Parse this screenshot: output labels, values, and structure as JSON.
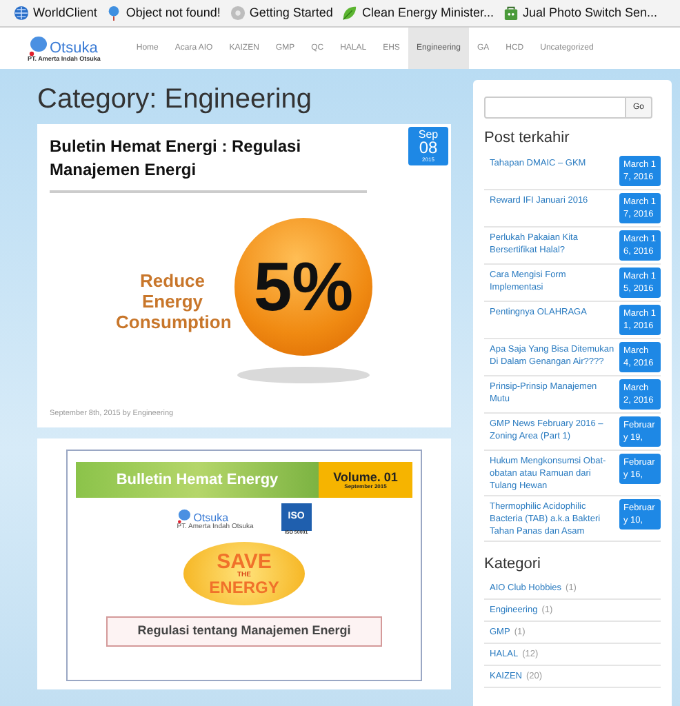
{
  "bookmarks": [
    {
      "label": "WorldClient",
      "kind": "globe"
    },
    {
      "label": "Object not found!",
      "kind": "pin"
    },
    {
      "label": "Getting Started",
      "kind": "disc"
    },
    {
      "label": "Clean Energy Minister...",
      "kind": "leaf"
    },
    {
      "label": "Jual Photo Switch Sen...",
      "kind": "bag"
    }
  ],
  "nav": {
    "logo": {
      "name": "Otsuka",
      "subtitle": "PT. Amerta Indah Otsuka"
    },
    "items": [
      {
        "label": "Home",
        "selected": false
      },
      {
        "label": "Acara AIO",
        "selected": false
      },
      {
        "label": "KAIZEN",
        "selected": false
      },
      {
        "label": "GMP",
        "selected": false
      },
      {
        "label": "QC",
        "selected": false
      },
      {
        "label": "HALAL",
        "selected": false
      },
      {
        "label": "EHS",
        "selected": false
      },
      {
        "label": "Engineering",
        "selected": true
      },
      {
        "label": "GA",
        "selected": false
      },
      {
        "label": "HCD",
        "selected": false
      },
      {
        "label": "Uncategorized",
        "selected": false
      }
    ]
  },
  "page_title": "Category: Engineering",
  "posts": [
    {
      "title": "Buletin Hemat Energi : Regulasi Manajemen Energi",
      "date": {
        "month": "Sep",
        "day": "08",
        "year": "2015"
      },
      "image": {
        "kind": "reduce",
        "caption": "Reduce Energy Consumption",
        "figure": "5%"
      },
      "meta": "September 8th, 2015 by Engineering"
    },
    {
      "image": {
        "kind": "bulletin",
        "banner": "Bulletin Hemat Energy",
        "volume": "Volume. 01",
        "volume_date": "September 2015",
        "logo": "Otsuka",
        "logo_subtitle": "PT. Amerta Indah Otsuka",
        "badge": "ISO",
        "badge_caption": "ISO 50001",
        "slogan_top": "SAVE",
        "slogan_middle": "THE",
        "slogan_bottom": "ENERGY",
        "ribbon": "Regulasi tentang Manajemen Energi"
      }
    }
  ],
  "sidebar": {
    "search": {
      "button": "Go"
    },
    "recent": {
      "heading": "Post terkahir",
      "items": [
        {
          "title": "Tahapan DMAIC – GKM",
          "date": "March 17, 2016"
        },
        {
          "title": "Reward IFI Januari 2016",
          "date": "March 17, 2016"
        },
        {
          "title": "Perlukah Pakaian Kita Bersertifikat Halal?",
          "date": "March 16, 2016"
        },
        {
          "title": "Cara Mengisi Form Implementasi",
          "date": "March 15, 2016"
        },
        {
          "title": "Pentingnya OLAHRAGA",
          "date": "March 11, 2016"
        },
        {
          "title": "Apa Saja Yang Bisa Ditemukan Di Dalam Genangan Air????",
          "date": "March 4, 2016"
        },
        {
          "title": "Prinsip-Prinsip Manajemen Mutu",
          "date": "March 2, 2016"
        },
        {
          "title": "GMP News February 2016 – Zoning Area (Part 1)",
          "date": "February 19,"
        },
        {
          "title": "Hukum Mengkonsumsi Obat-obatan atau Ramuan dari Tulang Hewan",
          "date": "February 16,"
        },
        {
          "title": "Thermophilic Acidophilic Bacteria (TAB) a.k.a Bakteri Tahan Panas dan Asam",
          "date": "February 10,"
        }
      ]
    },
    "categories": {
      "heading": "Kategori",
      "items": [
        {
          "name": "AIO Club Hobbies",
          "count": "(1)"
        },
        {
          "name": "Engineering",
          "count": "(1)"
        },
        {
          "name": "GMP",
          "count": "(1)"
        },
        {
          "name": "HALAL",
          "count": "(12)"
        },
        {
          "name": "KAIZEN",
          "count": "(20)"
        }
      ]
    }
  }
}
